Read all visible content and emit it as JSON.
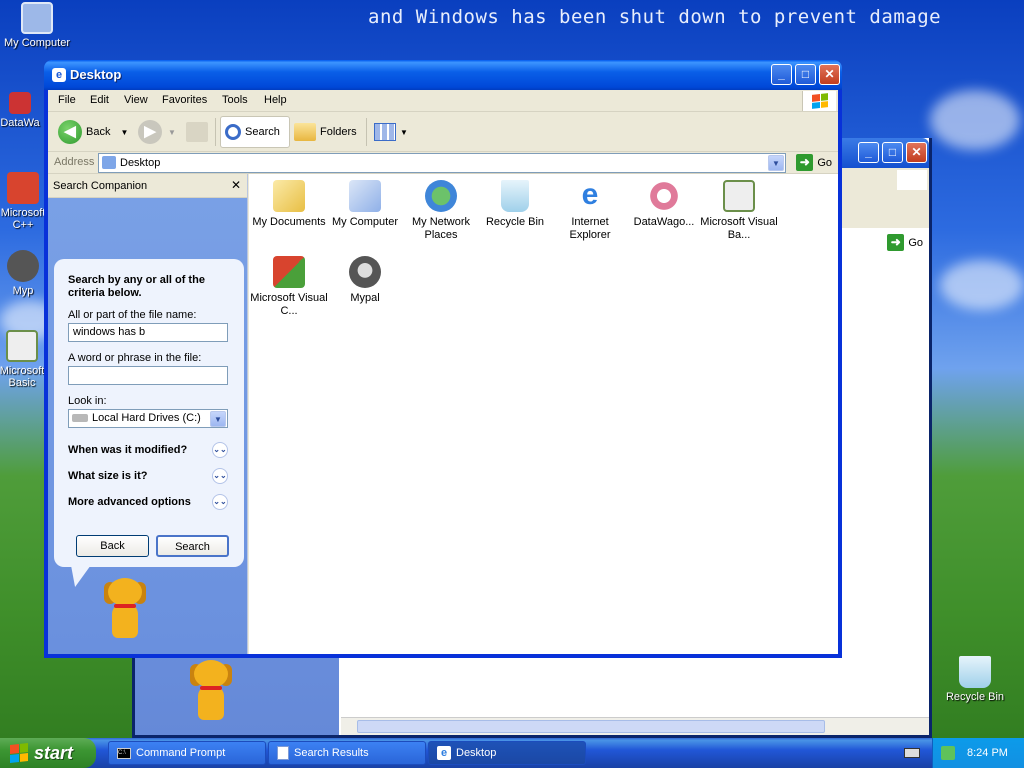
{
  "desktop": {
    "banner": "and Windows has been shut down to prevent damage",
    "icons": [
      {
        "label": "My Computer",
        "icon": "my-computer-icon"
      },
      {
        "label": "DataWa",
        "icon": "datawagon-shortcut-icon"
      },
      {
        "label": "Microsoft C++",
        "icon": "visual-cpp-shortcut-icon"
      },
      {
        "label": "Myp",
        "icon": "mypal-shortcut-icon"
      },
      {
        "label": "Microsoft Basic",
        "icon": "visual-basic-shortcut-icon"
      },
      {
        "label": "Recycle Bin",
        "icon": "recycle-bin-icon"
      }
    ]
  },
  "back_window": {
    "go_label": "Go"
  },
  "window": {
    "title": "Desktop",
    "menu": [
      "File",
      "Edit",
      "View",
      "Favorites",
      "Tools",
      "Help"
    ],
    "toolbar": {
      "back_label": "Back",
      "search_label": "Search",
      "folders_label": "Folders"
    },
    "address": {
      "label": "Address",
      "value": "Desktop",
      "go_label": "Go"
    }
  },
  "search_pane": {
    "header": "Search Companion",
    "close_glyph": "✕",
    "intro": "Search by any or all of the criteria below.",
    "filename_label": "All or part of the file name:",
    "filename_value": "windows has b",
    "phrase_label": "A word or phrase in the file:",
    "phrase_value": "",
    "lookin_label": "Look in:",
    "lookin_value": "Local Hard Drives (C:)",
    "sections": [
      "When was it modified?",
      "What size is it?",
      "More advanced options"
    ],
    "back_button": "Back",
    "search_button": "Search"
  },
  "files": [
    {
      "label": "My Documents",
      "icon": "my-documents-icon",
      "color": "#f4d26a"
    },
    {
      "label": "My Computer",
      "icon": "my-computer-icon",
      "color": "#8fb0e8"
    },
    {
      "label": "My Network Places",
      "icon": "network-places-icon",
      "color": "#3f86d9"
    },
    {
      "label": "Recycle Bin",
      "icon": "recycle-bin-icon",
      "color": "#9fd0ea"
    },
    {
      "label": "Internet Explorer",
      "icon": "internet-explorer-icon",
      "color": "#2f7fe0"
    },
    {
      "label": "DataWago...",
      "icon": "datawagon-icon",
      "color": "#e07a9a"
    },
    {
      "label": "Microsoft Visual Ba...",
      "icon": "visual-basic-icon",
      "color": "#6b8f4a"
    },
    {
      "label": "Microsoft Visual C...",
      "icon": "visual-cpp-icon",
      "color": "#d8442e"
    },
    {
      "label": "Mypal",
      "icon": "mypal-icon",
      "color": "#555555"
    }
  ],
  "taskbar": {
    "start_label": "start",
    "items": [
      {
        "label": "Command Prompt",
        "icon": "command-prompt-icon"
      },
      {
        "label": "Search Results",
        "icon": "search-results-icon"
      },
      {
        "label": "Desktop",
        "icon": "ie-desktop-icon"
      }
    ],
    "clock": "8:24 PM"
  }
}
